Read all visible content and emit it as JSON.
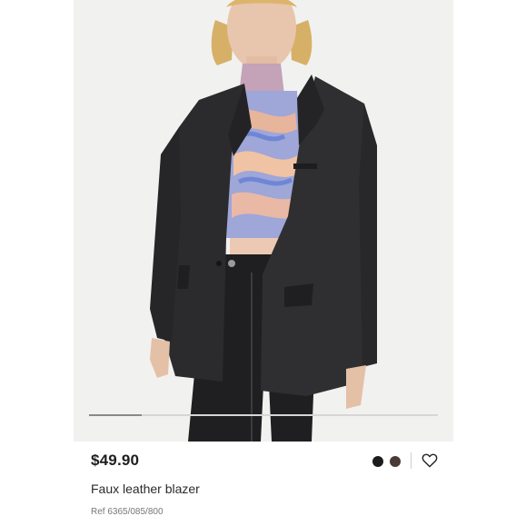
{
  "product": {
    "image_alt": "Model wearing black faux leather blazer over swirl print top",
    "image_position": 0.15,
    "price": "$49.90",
    "name": "Faux leather blazer",
    "reference": "Ref 6365/085/800",
    "colors": [
      {
        "name": "black",
        "hex": "#1c1c1c"
      },
      {
        "name": "brown",
        "hex": "#4a3a34"
      }
    ],
    "wishlist_icon": "heart-outline-icon"
  }
}
